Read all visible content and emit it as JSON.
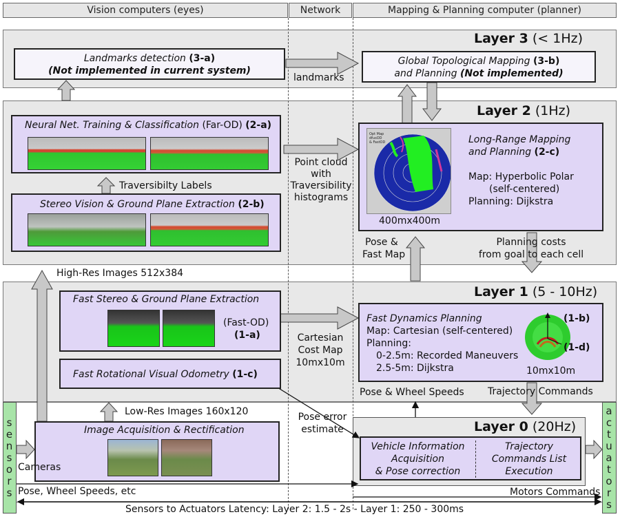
{
  "columns": {
    "left": "Vision computers (eyes)",
    "middle": "Network",
    "right": "Mapping & Planning computer (planner)"
  },
  "layer3": {
    "title_bold": "Layer 3",
    "title_rest": " (< 1Hz)",
    "landmarks_box": {
      "line1": "Landmarks detection ",
      "line1_tag": "(3-a)",
      "line2": "(Not implemented in current system)"
    },
    "net_label": "landmarks",
    "mapping_box": {
      "line1": "Global Topological Mapping ",
      "line1_tag": "(3-b)",
      "line2": "and Planning ",
      "line2_tag": "(Not implemented)"
    }
  },
  "layer2": {
    "title_bold": "Layer 2",
    "title_rest": " (1Hz)",
    "nn_box": {
      "label": "Neural Net. Training & Classification",
      "suffix": " (Far-OD) ",
      "tag": "(2-a)"
    },
    "trav_label": "Traversibilty Labels",
    "stereo_box": {
      "label": "Stereo Vision & Ground Plane Extraction ",
      "tag": "(2-b)"
    },
    "net_label": [
      "Point cloud",
      "with",
      "Traversibility",
      "histograms"
    ],
    "lr_box": {
      "title1": "Long-Range Mapping",
      "title2": "and Planning ",
      "tag": "(2-c)",
      "map1": "Map: Hyperbolic Polar",
      "map2": "(self-centered)",
      "planning": "Planning: Dijkstra",
      "size": "400mx400m",
      "legend": [
        "Opt Map",
        "dfusOD",
        "& FastOD"
      ]
    },
    "pose_label": [
      "Pose &",
      "Fast Map"
    ],
    "costs_label": [
      "Planning costs",
      "from goal to each cell"
    ]
  },
  "hires_label": "High-Res Images 512x384",
  "layer1": {
    "title_bold": "Layer 1",
    "title_rest": " (5 - 10Hz)",
    "fast_stereo": {
      "label": "Fast Stereo & Ground Plane Extraction",
      "tag_a": "(Fast-OD)",
      "tag_b": "(1-a)"
    },
    "odometry": {
      "label": "Fast Rotational Visual Odometry ",
      "tag": "(1-c)"
    },
    "net_label": [
      "Cartesian",
      "Cost Map",
      "10mx10m"
    ],
    "fdp_box": {
      "title": "Fast Dynamics Planning",
      "map": "Map: Cartesian (self-centered)",
      "planning": "Planning:",
      "range1": "0-2.5m: Recorded Maneuvers",
      "range2": "2.5-5m: Dijkstra",
      "size": "10mx10m",
      "tag_b": "(1-b)",
      "tag_d": "(1-d)"
    },
    "pose_wheel": "Pose & Wheel Speeds",
    "traj_cmds": "Trajectory Commands"
  },
  "lowres_label": "Low-Res Images 160x120",
  "layer0": {
    "title_bold": "Layer 0",
    "title_rest": " (20Hz)",
    "acq_box": {
      "label": "Image Acquisition & Rectification"
    },
    "pose_error": [
      "Pose error",
      "estimate"
    ],
    "vehicle": [
      "Vehicle Information",
      "Acquisition",
      "& Pose correction"
    ],
    "trajectory": [
      "Trajectory",
      "Commands List",
      "Execution"
    ],
    "cameras": "Cameras",
    "pose_wheel_etc": "Pose, Wheel Speeds, etc",
    "motors": "Motors Commands"
  },
  "sensors": "sensors",
  "actuators": "actuators",
  "latency": "Sensors to Actuators Latency: Layer 2: 1.5 - 2s - Layer 1: 250 - 300ms",
  "colors": {
    "box_fill": "#e0d6f6",
    "band_fill": "#e8e8e8",
    "side_fill": "#a8e4a8",
    "arrow_fill": "#c8c8c8",
    "map_blue": "#1a2aa8",
    "map_green": "#22ee22"
  }
}
